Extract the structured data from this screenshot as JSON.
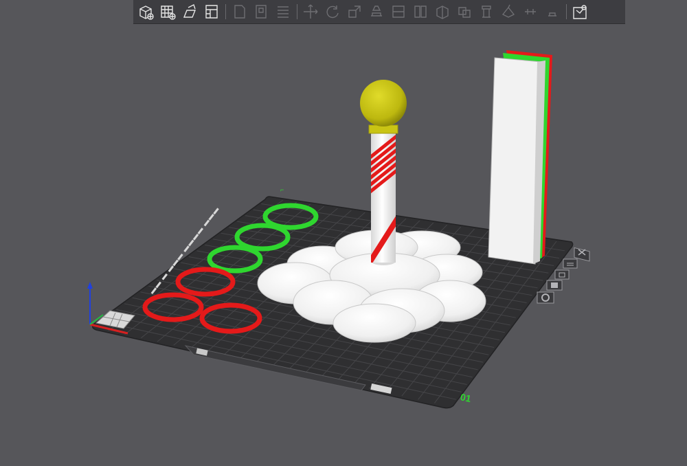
{
  "toolbar": {
    "buttons": [
      {
        "name": "add-object",
        "icon": "cube-plus-icon",
        "enabled": true
      },
      {
        "name": "arrange",
        "icon": "grid-arrange-icon",
        "enabled": true
      },
      {
        "name": "import-svg",
        "icon": "import-picture-icon",
        "enabled": true
      },
      {
        "name": "plate-layout",
        "icon": "plate-layout-icon",
        "enabled": true
      },
      {
        "name": "copy",
        "icon": "copy-icon",
        "enabled": false
      },
      {
        "name": "paste",
        "icon": "paste-icon",
        "enabled": false
      },
      {
        "name": "object-list",
        "icon": "list-icon",
        "enabled": false
      },
      {
        "name": "move",
        "icon": "move-icon",
        "enabled": false
      },
      {
        "name": "rotate",
        "icon": "rotate-icon",
        "enabled": false
      },
      {
        "name": "scale",
        "icon": "scale-icon",
        "enabled": false
      },
      {
        "name": "lay-on-face",
        "icon": "lay-on-face-icon",
        "enabled": false
      },
      {
        "name": "cut",
        "icon": "cut-icon",
        "enabled": false
      },
      {
        "name": "split-objects",
        "icon": "split-objects-icon",
        "enabled": false
      },
      {
        "name": "split-parts",
        "icon": "split-parts-icon",
        "enabled": false
      },
      {
        "name": "boolean",
        "icon": "boolean-icon",
        "enabled": false
      },
      {
        "name": "support-paint",
        "icon": "support-paint-icon",
        "enabled": false
      },
      {
        "name": "color-paint",
        "icon": "color-paint-icon",
        "enabled": false
      },
      {
        "name": "seam-paint",
        "icon": "seam-paint-icon",
        "enabled": false
      },
      {
        "name": "text-emboss",
        "icon": "text-emboss-icon",
        "enabled": false
      },
      {
        "name": "assembly-view",
        "icon": "assembly-view-icon",
        "enabled": true
      }
    ]
  },
  "colors": {
    "background": "#56565a",
    "toolbar": "#3d3d41",
    "plate": "#2f2f31",
    "grid": "#3f3f42",
    "filament_red": "#e41a1a",
    "filament_green": "#2fd62f",
    "filament_white": "#f2f2f2",
    "filament_yellow": "#c9c414",
    "axis_x": "#d62020",
    "axis_y": "#20c040",
    "axis_z": "#2040e0"
  },
  "scene": {
    "plate_number": "01",
    "objects": [
      "candy-cane-pole",
      "cloud-base",
      "ring-red-1",
      "ring-red-2",
      "ring-red-3",
      "ring-green-1",
      "ring-green-2",
      "ring-green-3",
      "wipe-tower"
    ]
  },
  "plate_buttons": [
    {
      "name": "plate-close-button",
      "icon": "close-icon"
    },
    {
      "name": "plate-arrange-button",
      "icon": "arrange-icon"
    },
    {
      "name": "plate-lock-button",
      "icon": "lock-icon"
    },
    {
      "name": "plate-orient-button",
      "icon": "orient-icon"
    },
    {
      "name": "plate-settings-button",
      "icon": "gear-icon"
    }
  ]
}
